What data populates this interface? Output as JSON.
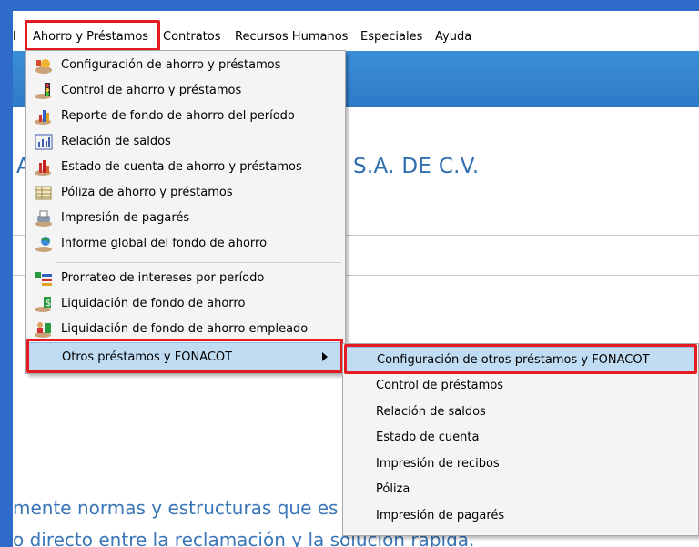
{
  "menubar": {
    "partial_prev": "l",
    "ahorro": "Ahorro y Préstamos",
    "contratos": "Contratos",
    "rh": "Recursos Humanos",
    "especiales": "Especiales",
    "ayuda": "Ayuda"
  },
  "background": {
    "company_prefix": "A",
    "company_suffix": "S.A. DE C.V.",
    "line1": "mente normas y estructuras que es",
    "line2": "o directo entre la reclamación y la solución rápida."
  },
  "menu": {
    "items": [
      {
        "label": "Configuración de ahorro y préstamos",
        "icon": "savings-config-icon"
      },
      {
        "label": "Control de ahorro y préstamos",
        "icon": "savings-control-icon"
      },
      {
        "label": "Reporte de fondo de ahorro del período",
        "icon": "bar-report-icon"
      },
      {
        "label": "Relación de saldos",
        "icon": "balance-chart-icon"
      },
      {
        "label": "Estado de cuenta de ahorro y préstamos",
        "icon": "statement-chart-icon"
      },
      {
        "label": "Póliza de ahorro y préstamos",
        "icon": "policy-grid-icon"
      },
      {
        "label": "Impresión de pagarés",
        "icon": "print-notes-icon"
      },
      {
        "label": "Informe global del fondo de ahorro",
        "icon": "global-report-icon"
      },
      {
        "label": "Prorrateo de intereses por período",
        "icon": "interest-proration-icon"
      },
      {
        "label": "Liquidación de fondo de ahorro",
        "icon": "fund-liquidation-icon"
      },
      {
        "label": "Liquidación de fondo de ahorro empleado",
        "icon": "employee-liquidation-icon"
      },
      {
        "label": "Otros préstamos y FONACOT",
        "icon": "submenu-arrow-icon"
      }
    ]
  },
  "submenu": {
    "items": [
      {
        "label": "Configuración  de otros préstamos y FONACOT"
      },
      {
        "label": "Control de préstamos"
      },
      {
        "label": "Relación de saldos"
      },
      {
        "label": "Estado de cuenta"
      },
      {
        "label": "Impresión de recibos"
      },
      {
        "label": "Póliza"
      },
      {
        "label": "Impresión de pagarés"
      }
    ]
  },
  "colors": {
    "frame": "#2f6cc9",
    "highlight": "#c0dcf3",
    "annotation": "#e41b23",
    "company_text": "#2f6fb1"
  }
}
